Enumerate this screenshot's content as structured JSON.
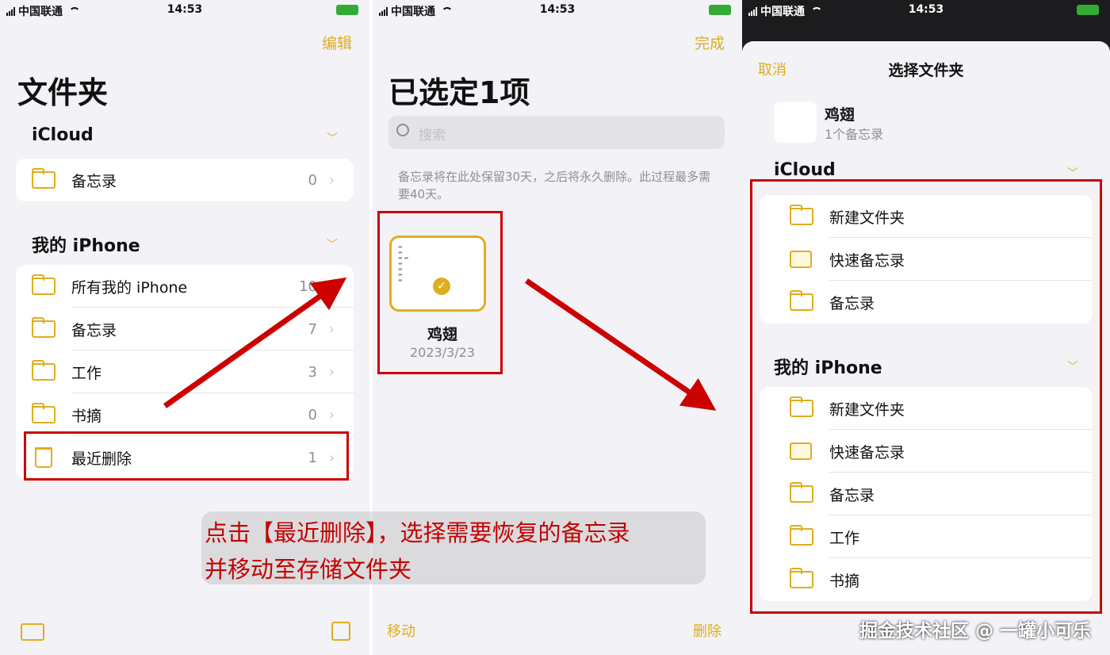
{
  "status": {
    "carrier": "中国联通",
    "time": "14:53"
  },
  "screen1": {
    "edit": "编辑",
    "title": "文件夹",
    "icloud": {
      "title": "iCloud",
      "items": [
        {
          "label": "备忘录",
          "count": "0"
        }
      ]
    },
    "iphone": {
      "title": "我的 iPhone",
      "items": [
        {
          "label": "所有我的 iPhone",
          "count": "10"
        },
        {
          "label": "备忘录",
          "count": "7"
        },
        {
          "label": "工作",
          "count": "3"
        },
        {
          "label": "书摘",
          "count": "0"
        },
        {
          "label": "最近删除",
          "count": "1"
        }
      ]
    }
  },
  "screen2": {
    "done": "完成",
    "title": "已选定1项",
    "search_placeholder": "搜索",
    "info": "备忘录将在此处保留30天，之后将永久删除。此过程最多需要40天。",
    "note": {
      "name": "鸡翅",
      "date": "2023/3/23"
    },
    "move": "移动",
    "delete": "删除"
  },
  "screen3": {
    "cancel": "取消",
    "title": "选择文件夹",
    "note": {
      "name": "鸡翅",
      "sub": "1个备忘录"
    },
    "icloud": {
      "title": "iCloud",
      "items": [
        "新建文件夹",
        "快速备忘录",
        "备忘录"
      ]
    },
    "iphone": {
      "title": "我的 iPhone",
      "items": [
        "新建文件夹",
        "快速备忘录",
        "备忘录",
        "工作",
        "书摘"
      ]
    }
  },
  "caption": {
    "line1": "点击【最近删除】，选择需要恢复的备忘录",
    "line2": "并移动至存储文件夹"
  },
  "watermark": "掘金技术社区 @ 一罐小可乐",
  "colors": {
    "accent": "#e0ad1c",
    "annotation": "#cc0000"
  }
}
